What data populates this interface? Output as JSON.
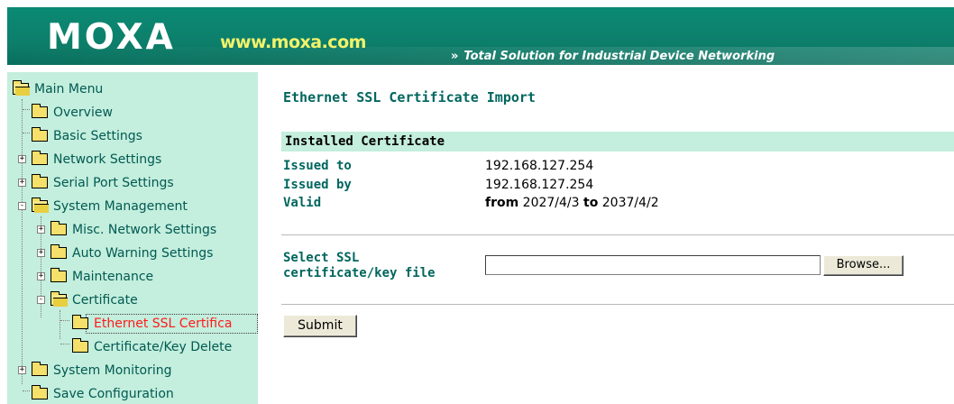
{
  "header": {
    "logo": "MOXA",
    "site_url": "www.moxa.com",
    "tagline_arrows": "»",
    "tagline": "Total Solution for Industrial Device Networking",
    "colors": {
      "banner": "#0c7f6b",
      "url": "#f3f26a"
    }
  },
  "sidebar": {
    "items": [
      {
        "label": "Main Menu",
        "icon": "folder-open-icon"
      },
      {
        "label": "Overview",
        "icon": "folder-icon"
      },
      {
        "label": "Basic Settings",
        "icon": "folder-icon"
      },
      {
        "label": "Network Settings",
        "icon": "folder-icon",
        "expander": "+"
      },
      {
        "label": "Serial Port Settings",
        "icon": "folder-icon",
        "expander": "+"
      },
      {
        "label": "System Management",
        "icon": "folder-open-icon",
        "expander": "-"
      },
      {
        "label": "Misc. Network Settings",
        "icon": "folder-icon",
        "expander": "+"
      },
      {
        "label": "Auto Warning Settings",
        "icon": "folder-icon",
        "expander": "+"
      },
      {
        "label": "Maintenance",
        "icon": "folder-icon",
        "expander": "+"
      },
      {
        "label": "Certificate",
        "icon": "folder-open-icon",
        "expander": "-"
      },
      {
        "label": "Ethernet SSL Certifica",
        "icon": "folder-icon",
        "selected": true
      },
      {
        "label": "Certificate/Key Delete",
        "icon": "folder-icon"
      },
      {
        "label": "System Monitoring",
        "icon": "folder-icon",
        "expander": "+"
      },
      {
        "label": "Save Configuration",
        "icon": "folder-icon"
      }
    ],
    "colors": {
      "background": "#c4eedd",
      "text": "#005a52",
      "selected_text": "#ff1a1a"
    }
  },
  "main": {
    "title": "Ethernet SSL Certificate Import",
    "installed": {
      "heading": "Installed Certificate",
      "issued_to_label": "Issued to",
      "issued_to_value": "192.168.127.254",
      "issued_by_label": "Issued by",
      "issued_by_value": "192.168.127.254",
      "valid_label": "Valid",
      "valid_from_word": "from",
      "valid_from": "2027/4/3",
      "valid_to_word": "to",
      "valid_to": "2037/4/2"
    },
    "select_label_line1": "Select SSL",
    "select_label_line2": "certificate/key file",
    "file_value": "",
    "browse_label": "Browse...",
    "submit_label": "Submit"
  }
}
